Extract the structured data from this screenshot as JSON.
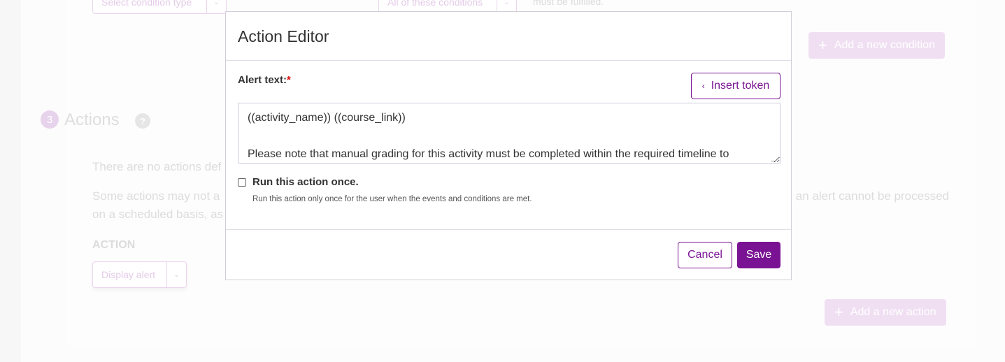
{
  "background": {
    "condition_type_select": "Select condition type",
    "conditions_match_select": "All of these conditions",
    "conditions_hint_fragment": "must be fulfilled.",
    "add_condition_button": "Add a new condition",
    "section_number": "3",
    "section_title": "Actions",
    "help_icon_text": "?",
    "no_actions_fragment": "There are no actions def",
    "note_line1_fragment_left": "Some actions may not a",
    "note_line1_fragment_right": "an alert cannot be processed",
    "note_line2_fragment": "on a scheduled basis, as",
    "action_label": "ACTION",
    "action_select": "Display alert",
    "add_action_button": "Add a new action"
  },
  "modal": {
    "title": "Action Editor",
    "alert_text_label": "Alert text:",
    "required_marker": "*",
    "insert_token_button": "Insert token",
    "alert_text_lines": [
      "((activity_name)) ((course_link))",
      "",
      "Please note that manual grading for this activity must be completed within the required timeline to"
    ],
    "run_once_label": "Run this action once.",
    "run_once_checked": false,
    "run_once_help": "Run this action only once for the user when the events and conditions are met.",
    "cancel_button": "Cancel",
    "save_button": "Save"
  },
  "colors": {
    "accent": "#7a1393",
    "required": "#dd0000"
  }
}
